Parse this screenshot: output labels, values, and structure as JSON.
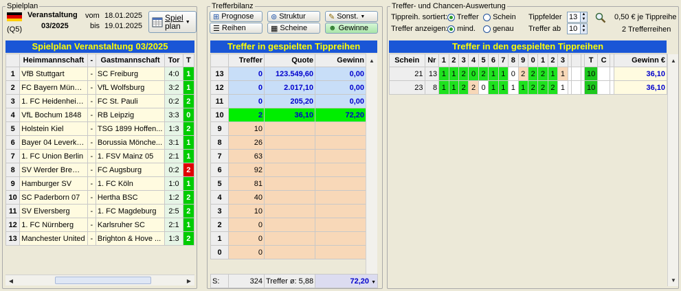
{
  "spielplan": {
    "group_title": "Spielplan",
    "veranstaltung_label": "Veranstaltung",
    "veranstaltung_nr": "03/2025",
    "q_label": "(Q5)",
    "vom_label": "vom",
    "bis_label": "bis",
    "vom_date": "18.01.2025",
    "bis_date": "19.01.2025",
    "plan_button": "Spiel plan",
    "plan_button_l1": "Spiel",
    "plan_button_l2": "plan",
    "table_title": "Spielplan Veranstaltung 03/2025",
    "headers": {
      "heim": "Heimmannschaft",
      "dash": "-",
      "gast": "Gastmannschaft",
      "tor": "Tor",
      "t": "T"
    },
    "rows": [
      {
        "nr": "1",
        "heim": "VfB Stuttgart",
        "gast": "SC Freiburg",
        "tor": "4:0",
        "t": "1",
        "tc": "g"
      },
      {
        "nr": "2",
        "heim": "FC Bayern Münch...",
        "gast": "VfL Wolfsburg",
        "tor": "3:2",
        "t": "1",
        "tc": "g"
      },
      {
        "nr": "3",
        "heim": "1. FC Heidenheim...",
        "gast": "FC St. Pauli",
        "tor": "0:2",
        "t": "2",
        "tc": "g"
      },
      {
        "nr": "4",
        "heim": "VfL Bochum 1848",
        "gast": "RB Leipzig",
        "tor": "3:3",
        "t": "0",
        "tc": "g"
      },
      {
        "nr": "5",
        "heim": "Holstein Kiel",
        "gast": "TSG 1899 Hoffen...",
        "tor": "1:3",
        "t": "2",
        "tc": "g"
      },
      {
        "nr": "6",
        "heim": "Bayer 04 Leverku...",
        "gast": "Borussia Mönche...",
        "tor": "3:1",
        "t": "1",
        "tc": "g"
      },
      {
        "nr": "7",
        "heim": "1. FC Union Berlin",
        "gast": "1. FSV Mainz 05",
        "tor": "2:1",
        "t": "1",
        "tc": "g"
      },
      {
        "nr": "8",
        "heim": "SV Werder Bremen",
        "gast": "FC Augsburg",
        "tor": "0:2",
        "t": "2",
        "tc": "r"
      },
      {
        "nr": "9",
        "heim": "Hamburger SV",
        "gast": "1. FC Köln",
        "tor": "1:0",
        "t": "1",
        "tc": "g"
      },
      {
        "nr": "10",
        "heim": "SC Paderborn 07",
        "gast": "Hertha BSC",
        "tor": "1:2",
        "t": "2",
        "tc": "g"
      },
      {
        "nr": "11",
        "heim": "SV Elversberg",
        "gast": "1. FC Magdeburg",
        "tor": "2:5",
        "t": "2",
        "tc": "g"
      },
      {
        "nr": "12",
        "heim": "1. FC Nürnberg",
        "gast": "Karlsruher SC",
        "tor": "2:1",
        "t": "1",
        "tc": "g"
      },
      {
        "nr": "13",
        "heim": "Manchester United",
        "gast": "Brighton & Hove ...",
        "tor": "1:3",
        "t": "2",
        "tc": "g"
      }
    ]
  },
  "bilanz": {
    "group_title": "Trefferbilanz",
    "buttons": {
      "prognose": "Prognose",
      "struktur": "Struktur",
      "sonst": "Sonst.",
      "reihen": "Reihen",
      "scheine": "Scheine",
      "gewinne": "Gewinne"
    },
    "table_title": "Treffer in gespielten Tippreihen",
    "headers": {
      "treffer": "Treffer",
      "quote": "Quote",
      "gewinn": "Gewinn"
    },
    "rows": [
      {
        "k": "13",
        "treffer": "0",
        "quote": "123.549,60",
        "gewinn": "0,00",
        "style": "blue"
      },
      {
        "k": "12",
        "treffer": "0",
        "quote": "2.017,10",
        "gewinn": "0,00",
        "style": "blue"
      },
      {
        "k": "11",
        "treffer": "0",
        "quote": "205,20",
        "gewinn": "0,00",
        "style": "blue"
      },
      {
        "k": "10",
        "treffer": "2",
        "quote": "36,10",
        "gewinn": "72,20",
        "style": "green"
      },
      {
        "k": "9",
        "treffer": "10",
        "quote": "",
        "gewinn": "",
        "style": "peach"
      },
      {
        "k": "8",
        "treffer": "26",
        "quote": "",
        "gewinn": "",
        "style": "peach"
      },
      {
        "k": "7",
        "treffer": "63",
        "quote": "",
        "gewinn": "",
        "style": "peach"
      },
      {
        "k": "6",
        "treffer": "92",
        "quote": "",
        "gewinn": "",
        "style": "peach"
      },
      {
        "k": "5",
        "treffer": "81",
        "quote": "",
        "gewinn": "",
        "style": "peach"
      },
      {
        "k": "4",
        "treffer": "40",
        "quote": "",
        "gewinn": "",
        "style": "peach"
      },
      {
        "k": "3",
        "treffer": "10",
        "quote": "",
        "gewinn": "",
        "style": "peach"
      },
      {
        "k": "2",
        "treffer": "0",
        "quote": "",
        "gewinn": "",
        "style": "peach"
      },
      {
        "k": "1",
        "treffer": "0",
        "quote": "",
        "gewinn": "",
        "style": "peach"
      },
      {
        "k": "0",
        "treffer": "0",
        "quote": "",
        "gewinn": "",
        "style": "peach"
      }
    ],
    "footer": {
      "s_label": "S:",
      "sum": "324",
      "avg": "Treffer ø:  5,88",
      "gewinn": "72,20"
    }
  },
  "auswertung": {
    "group_title": "Treffer- und Chancen-Auswertung",
    "sort_label": "Tippreih. sortiert:",
    "sort_options": [
      "Treffer",
      "Schein"
    ],
    "sort_selected": 0,
    "show_label": "Treffer anzeigen:",
    "show_options": [
      "mind.",
      "genau"
    ],
    "show_selected": 0,
    "tippfelder_label": "Tippfelder",
    "tippfelder_value": "13",
    "treffer_ab_label": "Treffer ab",
    "treffer_ab_value": "10",
    "price_text": "0,50 € je Tippreihe",
    "count_text": "2 Trefferreihen",
    "table_title": "Treffer in den gespielten Tippreihen",
    "headers": {
      "schein": "Schein",
      "nr": "Nr",
      "cols": [
        "1",
        "2",
        "3",
        "4",
        "5",
        "6",
        "7",
        "8",
        "9",
        "0",
        "1",
        "2",
        "3"
      ],
      "t": "T",
      "c": "C",
      "gewinn": "Gewinn €"
    },
    "rows": [
      {
        "schein": "21",
        "nr": "13",
        "cells": [
          [
            "1",
            "g"
          ],
          [
            "1",
            "g"
          ],
          [
            "2",
            "g"
          ],
          [
            "0",
            "g"
          ],
          [
            "2",
            "g"
          ],
          [
            "1",
            "g"
          ],
          [
            "1",
            "g"
          ],
          [
            "0",
            "w"
          ],
          [
            "2",
            "p"
          ],
          [
            "2",
            "g"
          ],
          [
            "2",
            "g"
          ],
          [
            "1",
            "g"
          ],
          [
            "1",
            "p"
          ]
        ],
        "t": "10",
        "c": "",
        "gewinn": "36,10"
      },
      {
        "schein": "23",
        "nr": "8",
        "cells": [
          [
            "1",
            "g"
          ],
          [
            "1",
            "g"
          ],
          [
            "2",
            "g"
          ],
          [
            "2",
            "p"
          ],
          [
            "0",
            "w"
          ],
          [
            "1",
            "g"
          ],
          [
            "1",
            "g"
          ],
          [
            "1",
            "w"
          ],
          [
            "1",
            "g"
          ],
          [
            "2",
            "g"
          ],
          [
            "2",
            "g"
          ],
          [
            "2",
            "g"
          ],
          [
            "1",
            "w"
          ]
        ],
        "t": "10",
        "c": "",
        "gewinn": "36,10"
      }
    ]
  },
  "icons": {
    "flag": "german-flag-icon",
    "magnifier": "magnifier-icon"
  },
  "colors": {
    "accent_blue": "#1a56d6",
    "title_yellow": "#ffff00",
    "hit_green": "#00cc00",
    "miss_red": "#e00000",
    "peach": "#f8d8b8"
  }
}
